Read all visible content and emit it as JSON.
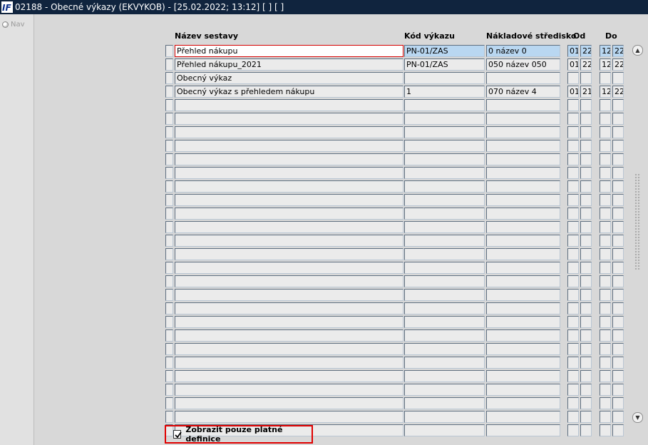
{
  "window": {
    "title": "02188 - Obecné výkazy (EKVYKOB) - [25.02.2022; 13:12]  [ ]  [ ]"
  },
  "nav": {
    "label": "Nav"
  },
  "columns": {
    "name": "Název sestavy",
    "code": "Kód výkazu",
    "center": "Nákladové středisko",
    "from": "Od",
    "to": "Do"
  },
  "rows": [
    {
      "name": "Přehled nákupu",
      "code": "PN-01/ZAS",
      "center": "0 název 0",
      "od1": "01",
      "od2": "22",
      "do1": "12",
      "do2": "22"
    },
    {
      "name": "Přehled nákupu_2021",
      "code": "PN-01/ZAS",
      "center": "050 název 050",
      "od1": "01",
      "od2": "22",
      "do1": "12",
      "do2": "22"
    },
    {
      "name": "Obecný výkaz",
      "code": "",
      "center": "",
      "od1": "",
      "od2": "",
      "do1": "",
      "do2": ""
    },
    {
      "name": "Obecný výkaz s přehledem nákupu",
      "code": "1",
      "center": "070 název 4",
      "od1": "01",
      "od2": "21",
      "do1": "12",
      "do2": "22"
    },
    {
      "name": "",
      "code": "",
      "center": "",
      "od1": "",
      "od2": "",
      "do1": "",
      "do2": ""
    },
    {
      "name": "",
      "code": "",
      "center": "",
      "od1": "",
      "od2": "",
      "do1": "",
      "do2": ""
    },
    {
      "name": "",
      "code": "",
      "center": "",
      "od1": "",
      "od2": "",
      "do1": "",
      "do2": ""
    },
    {
      "name": "",
      "code": "",
      "center": "",
      "od1": "",
      "od2": "",
      "do1": "",
      "do2": ""
    },
    {
      "name": "",
      "code": "",
      "center": "",
      "od1": "",
      "od2": "",
      "do1": "",
      "do2": ""
    },
    {
      "name": "",
      "code": "",
      "center": "",
      "od1": "",
      "od2": "",
      "do1": "",
      "do2": ""
    },
    {
      "name": "",
      "code": "",
      "center": "",
      "od1": "",
      "od2": "",
      "do1": "",
      "do2": ""
    },
    {
      "name": "",
      "code": "",
      "center": "",
      "od1": "",
      "od2": "",
      "do1": "",
      "do2": ""
    },
    {
      "name": "",
      "code": "",
      "center": "",
      "od1": "",
      "od2": "",
      "do1": "",
      "do2": ""
    },
    {
      "name": "",
      "code": "",
      "center": "",
      "od1": "",
      "od2": "",
      "do1": "",
      "do2": ""
    },
    {
      "name": "",
      "code": "",
      "center": "",
      "od1": "",
      "od2": "",
      "do1": "",
      "do2": ""
    },
    {
      "name": "",
      "code": "",
      "center": "",
      "od1": "",
      "od2": "",
      "do1": "",
      "do2": ""
    },
    {
      "name": "",
      "code": "",
      "center": "",
      "od1": "",
      "od2": "",
      "do1": "",
      "do2": ""
    },
    {
      "name": "",
      "code": "",
      "center": "",
      "od1": "",
      "od2": "",
      "do1": "",
      "do2": ""
    },
    {
      "name": "",
      "code": "",
      "center": "",
      "od1": "",
      "od2": "",
      "do1": "",
      "do2": ""
    },
    {
      "name": "",
      "code": "",
      "center": "",
      "od1": "",
      "od2": "",
      "do1": "",
      "do2": ""
    },
    {
      "name": "",
      "code": "",
      "center": "",
      "od1": "",
      "od2": "",
      "do1": "",
      "do2": ""
    },
    {
      "name": "",
      "code": "",
      "center": "",
      "od1": "",
      "od2": "",
      "do1": "",
      "do2": ""
    },
    {
      "name": "",
      "code": "",
      "center": "",
      "od1": "",
      "od2": "",
      "do1": "",
      "do2": ""
    },
    {
      "name": "",
      "code": "",
      "center": "",
      "od1": "",
      "od2": "",
      "do1": "",
      "do2": ""
    },
    {
      "name": "",
      "code": "",
      "center": "",
      "od1": "",
      "od2": "",
      "do1": "",
      "do2": ""
    },
    {
      "name": "",
      "code": "",
      "center": "",
      "od1": "",
      "od2": "",
      "do1": "",
      "do2": ""
    },
    {
      "name": "",
      "code": "",
      "center": "",
      "od1": "",
      "od2": "",
      "do1": "",
      "do2": ""
    },
    {
      "name": "",
      "code": "",
      "center": "",
      "od1": "",
      "od2": "",
      "do1": "",
      "do2": ""
    },
    {
      "name": "",
      "code": "",
      "center": "",
      "od1": "",
      "od2": "",
      "do1": "",
      "do2": ""
    }
  ],
  "selected_row": 0,
  "footer": {
    "checkbox_label": "Zobrazit pouze platné definice",
    "checked": true
  },
  "colors": {
    "titlebar": "#10243e",
    "selection": "#b9d7f1",
    "highlight": "#e00000"
  },
  "icons": {
    "app": "app-logo-icon",
    "scroll_up": "arrow-up-icon",
    "scroll_down": "arrow-down-icon",
    "check": "checkmark-icon"
  }
}
